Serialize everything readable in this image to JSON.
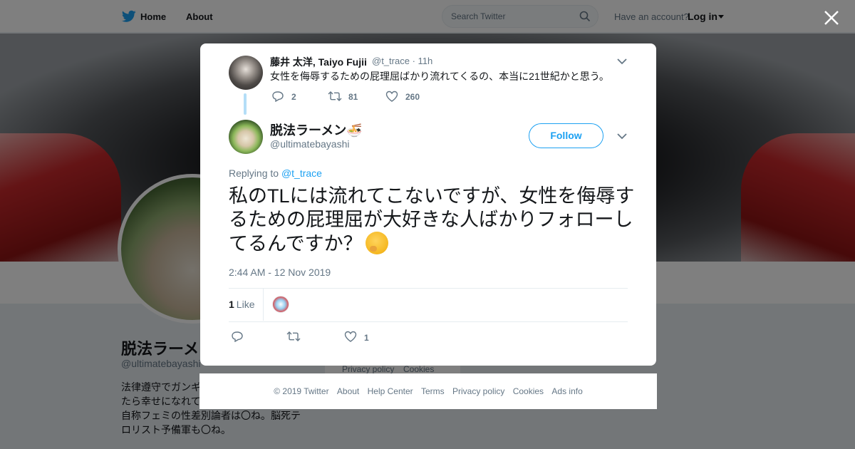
{
  "nav": {
    "home_label": "Home",
    "about_label": "About",
    "search_placeholder": "Search Twitter",
    "have_account": "Have an account?",
    "login_label": "Log in"
  },
  "background_profile": {
    "name": "脱法ラーメン",
    "handle": "@ultimatebayashi",
    "bio_lines": [
      "法律遵守でガンギ",
      "たら幸せになれて",
      "自称フェミの性差別論者は〇ね。脳死テ",
      "ロリスト予備軍も〇ね。"
    ],
    "footer_links": [
      "Privacy policy",
      "Cookies"
    ]
  },
  "parent_tweet": {
    "name": "藤井 太洋, Taiyo Fujii",
    "handle": "@t_trace",
    "time": "· 11h",
    "text": "女性を侮辱するための屁理屈ばかり流れてくるの、本当に21世紀かと思う。",
    "replies": "2",
    "retweets": "81",
    "likes": "260"
  },
  "main_tweet": {
    "name": "脱法ラーメン🍜",
    "handle": "@ultimatebayashi",
    "follow_label": "Follow",
    "replying_prefix": "Replying to",
    "replying_to": "@t_trace",
    "text": "私のTLには流れてこないですが、女性を侮辱するための屁理屈が大好きな人ばかりフォローしてるんですか？",
    "timestamp": "2:44 AM - 12 Nov 2019",
    "like_count": "1",
    "like_label": "Like",
    "action_likes": "1"
  },
  "footer": {
    "links": [
      "© 2019 Twitter",
      "About",
      "Help Center",
      "Terms",
      "Privacy policy",
      "Cookies",
      "Ads info"
    ]
  },
  "colors": {
    "accent": "#1da1f2",
    "muted": "#657786",
    "text": "#14171a",
    "thread_line": "#b4def7"
  },
  "icons": [
    "twitter-bird-icon",
    "search-icon",
    "close-icon",
    "chevron-down-icon",
    "reply-icon",
    "retweet-icon",
    "heart-icon",
    "thinking-emoji-icon"
  ]
}
